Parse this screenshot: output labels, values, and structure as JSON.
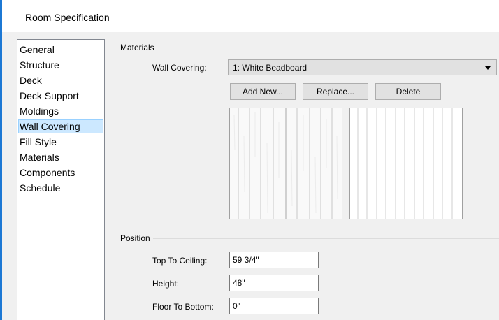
{
  "window": {
    "title": "Room Specification"
  },
  "sidebar": {
    "items": [
      {
        "label": "General"
      },
      {
        "label": "Structure"
      },
      {
        "label": "Deck"
      },
      {
        "label": "Deck Support"
      },
      {
        "label": "Moldings"
      },
      {
        "label": "Wall Covering"
      },
      {
        "label": "Fill Style"
      },
      {
        "label": "Materials"
      },
      {
        "label": "Components"
      },
      {
        "label": "Schedule"
      }
    ],
    "selected": "Wall Covering"
  },
  "materials": {
    "group_label": "Materials",
    "wall_covering_label": "Wall Covering:",
    "wall_covering_value": "1:  White Beadboard",
    "add_new_label": "Add New...",
    "replace_label": "Replace...",
    "delete_label": "Delete"
  },
  "position": {
    "group_label": "Position",
    "top_to_ceiling_label": "Top To Ceiling:",
    "top_to_ceiling_value": "59 3/4\"",
    "height_label": "Height:",
    "height_value": "48\"",
    "floor_to_bottom_label": "Floor To Bottom:",
    "floor_to_bottom_value": "0\""
  },
  "colors": {
    "accent": "#1c78d4",
    "selection": "#cce8ff",
    "dialog_bg": "#f0f0f0"
  }
}
